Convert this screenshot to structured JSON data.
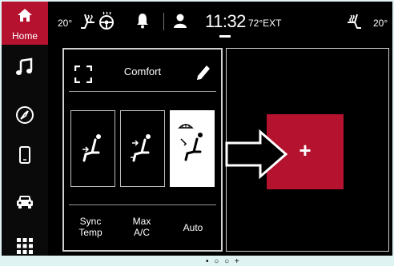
{
  "sidebar": {
    "home_label": "Home",
    "items": [
      {
        "icon": "home-icon",
        "label": "Home"
      },
      {
        "icon": "music-note-icon"
      },
      {
        "icon": "navigation-compass-icon"
      },
      {
        "icon": "phone-icon"
      },
      {
        "icon": "car-icon"
      },
      {
        "icon": "apps-grid-icon"
      }
    ]
  },
  "status_bar": {
    "left_temp": "20°",
    "clock": "11:32",
    "exterior_temp": "72°EXT",
    "right_temp": "20°"
  },
  "climate_panel": {
    "title": "Comfort",
    "seat_modes": [
      {
        "icon": "seat-face-airflow-icon",
        "active": false
      },
      {
        "icon": "seat-face-feet-airflow-icon",
        "active": false
      },
      {
        "icon": "seat-defrost-airflow-icon",
        "active": true
      }
    ],
    "buttons": {
      "sync_line1": "Sync",
      "sync_line2": "Temp",
      "max_line1": "Max",
      "max_line2": "A/C",
      "auto": "Auto"
    }
  },
  "add_widget": {
    "label": "+"
  },
  "page_indicator": "• ○ ○ +",
  "colors": {
    "accent": "#b4122f",
    "background": "#000000",
    "frame": "#dff3f3"
  }
}
